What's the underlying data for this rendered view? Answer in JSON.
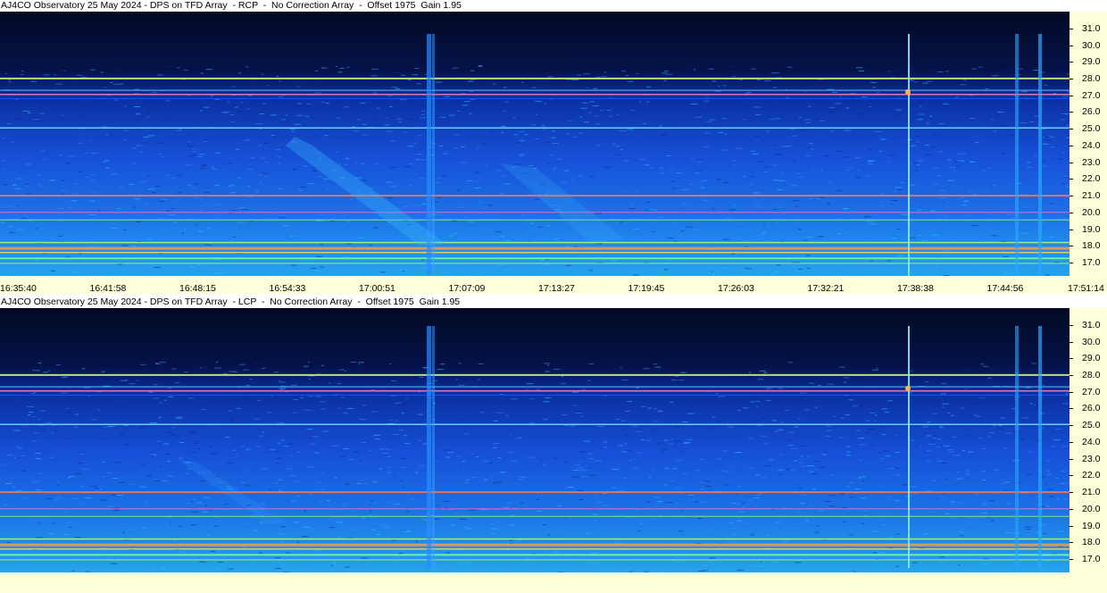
{
  "panels": [
    {
      "id": "rcp",
      "title": "AJ4CO Observatory 25 May 2024 - DPS on TFD Array  - RCP  -  No Correction Array  -  Offset 1975  Gain 1.95"
    },
    {
      "id": "lcp",
      "title": "AJ4CO Observatory 25 May 2024 - DPS on TFD Array  - LCP  -  No Correction Array  -  Offset 1975  Gain 1.95"
    }
  ],
  "chart_data": {
    "type": "heatmap",
    "y_ticks": [
      "31.0",
      "30.0",
      "29.0",
      "28.0",
      "27.0",
      "26.0",
      "25.0",
      "24.0",
      "23.0",
      "22.0",
      "21.0",
      "20.0",
      "19.0",
      "18.0",
      "17.0"
    ],
    "x_ticks": [
      "16:35:40",
      "16:41:58",
      "16:48:15",
      "16:54:33",
      "17:00:51",
      "17:07:09",
      "17:13:27",
      "17:19:45",
      "17:26:03",
      "17:32:21",
      "17:38:38",
      "17:44:56",
      "17:51:14"
    ],
    "ylim": [
      16.2,
      32.0
    ],
    "xlim": [
      "16:35:40",
      "17:51:14"
    ],
    "colors": {
      "background_low": "#030c2e",
      "mid": "#1a52d6",
      "high": "#22b6ee",
      "hot": "#ff8a3a",
      "line_green": "#b8ff6a",
      "axis_bg": "#ffffd9"
    }
  }
}
